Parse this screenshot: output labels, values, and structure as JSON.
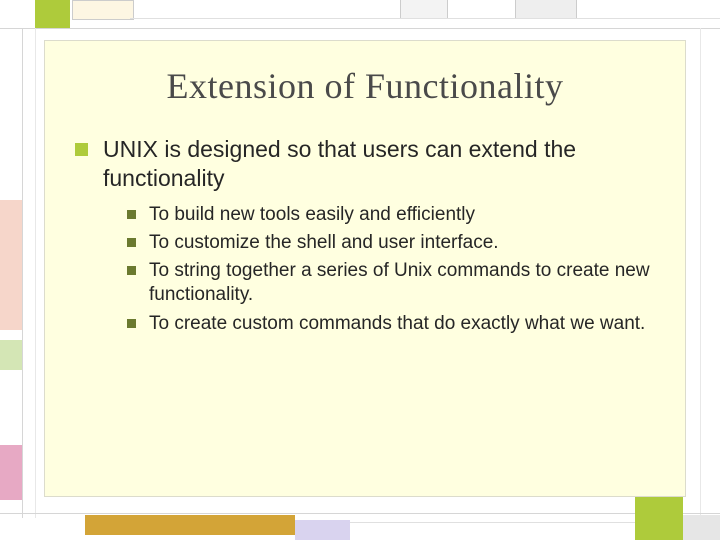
{
  "slide": {
    "title": "Extension of Functionality",
    "main_point": "UNIX is designed so that users can extend the functionality",
    "sub_points": {
      "p1": "To build new tools easily and efficiently",
      "p2": "To customize the shell and user interface.",
      "p3": "To string together a series of Unix commands to create new functionality.",
      "p4": "To create custom commands that do exactly what we want."
    }
  },
  "colors": {
    "accent_green": "#aecb3b",
    "dark_bullet": "#6b7a2f",
    "content_bg": "#ffffe0"
  }
}
